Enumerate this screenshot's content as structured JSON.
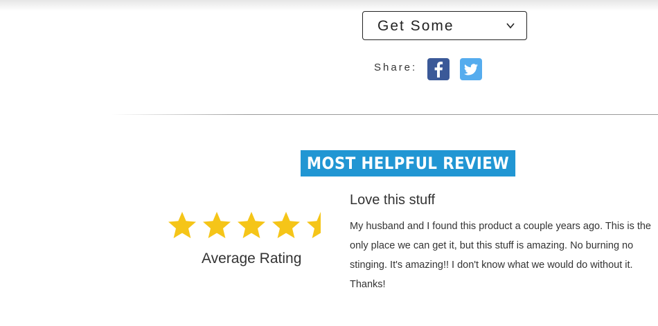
{
  "product_options": {
    "dropdown_label": "Get Some",
    "dropdown_icon": "chevron-down-icon"
  },
  "share": {
    "label": "Share:",
    "networks": [
      {
        "name": "facebook",
        "icon": "facebook-icon",
        "color": "#3b5998"
      },
      {
        "name": "twitter",
        "icon": "twitter-icon",
        "color": "#55acee"
      }
    ]
  },
  "review_section": {
    "heading": "MOST HELPFUL REVIEW",
    "heading_color": "#2196d3",
    "rating": {
      "value": 4.5,
      "max": 5,
      "label": "Average Rating",
      "star_color": "#f5c518"
    },
    "review": {
      "title": "Love this stuff",
      "body": "My husband and I found this product a couple years ago. This is the only place we can get it, but this stuff is amazing. No burning no stinging. It's amazing!! I don't know what we would do without it. Thanks!"
    }
  }
}
